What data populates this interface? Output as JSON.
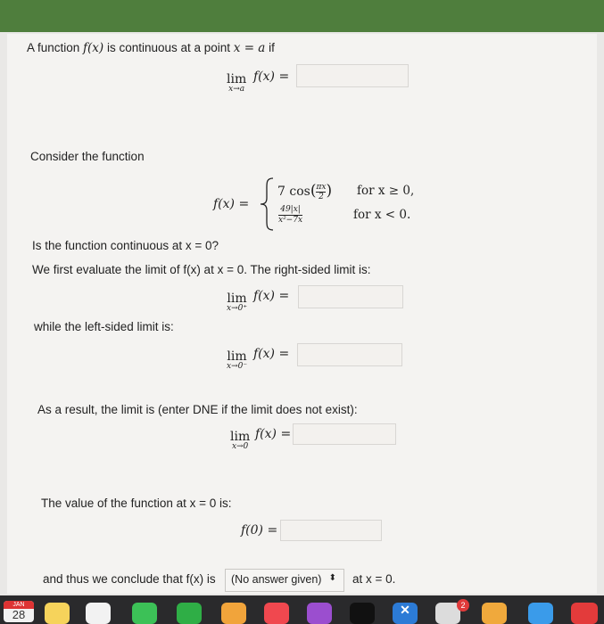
{
  "intro": {
    "text_pre": "A function ",
    "fx": "f(x)",
    "text_mid": " is continuous at a point ",
    "cond": "x = a",
    "text_post": " if"
  },
  "limit_def": {
    "lim": "lim",
    "sub": "x→a",
    "expr": "f(x) ="
  },
  "consider": "Consider the function",
  "piecewise": {
    "lhs": "f(x) =",
    "case1_expr": "7 cos",
    "case1_num": "πx",
    "case1_den": "2",
    "case1_cond": "for x ≥ 0,",
    "case2_num": "49|x|",
    "case2_den": "x²−7x",
    "case2_cond": "for x < 0."
  },
  "question": "Is the function continuous at x = 0?",
  "first_eval": "We first evaluate the limit of f(x) at x = 0. The right-sided limit is:",
  "right_limit": {
    "lim": "lim",
    "sub": "x→0⁺",
    "expr": "f(x) ="
  },
  "while_left": "while the left-sided limit is:",
  "left_limit": {
    "lim": "lim",
    "sub": "x→0⁻",
    "expr": "f(x) ="
  },
  "result_text": "As a result, the limit is (enter DNE if the limit does not exist):",
  "full_limit": {
    "lim": "lim",
    "sub": "x→0",
    "expr": "f(x) ="
  },
  "value_text": "The value of the function at x = 0 is:",
  "f0": "f(0) =",
  "conclude_pre": "and thus we conclude that f(x) is",
  "dropdown_value": "(No answer given)",
  "conclude_post": "at x = 0.",
  "taskbar": {
    "date_month": "JAN",
    "date_day": "28",
    "icons": [
      "notes-icon",
      "reminders-icon",
      "messages-icon",
      "facetime-icon",
      "pages-icon",
      "music-icon",
      "podcasts-icon",
      "appletv-icon",
      "x-icon",
      "chrome-icon",
      "photos-icon",
      "finder-icon",
      "app-icon"
    ],
    "badge": "2"
  }
}
